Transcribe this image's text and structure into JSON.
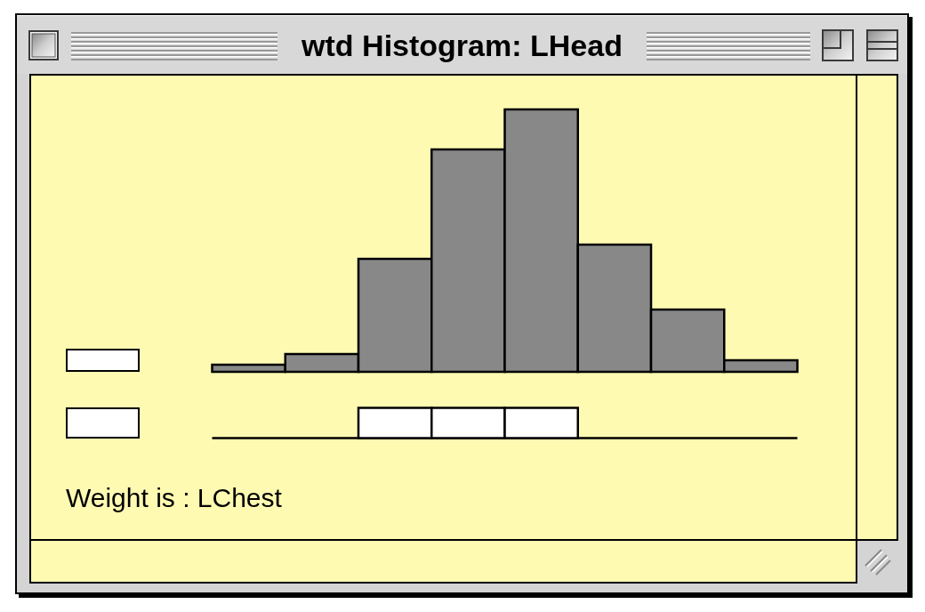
{
  "window": {
    "title": "wtd Histogram: LHead"
  },
  "histogram": {
    "bins": [
      {
        "selected": false
      },
      {
        "selected": false
      },
      {
        "selected": true
      },
      {
        "selected": true
      },
      {
        "selected": true
      },
      {
        "selected": false
      },
      {
        "selected": false
      },
      {
        "selected": false
      }
    ]
  },
  "weight_label": "Weight is : LChest"
}
